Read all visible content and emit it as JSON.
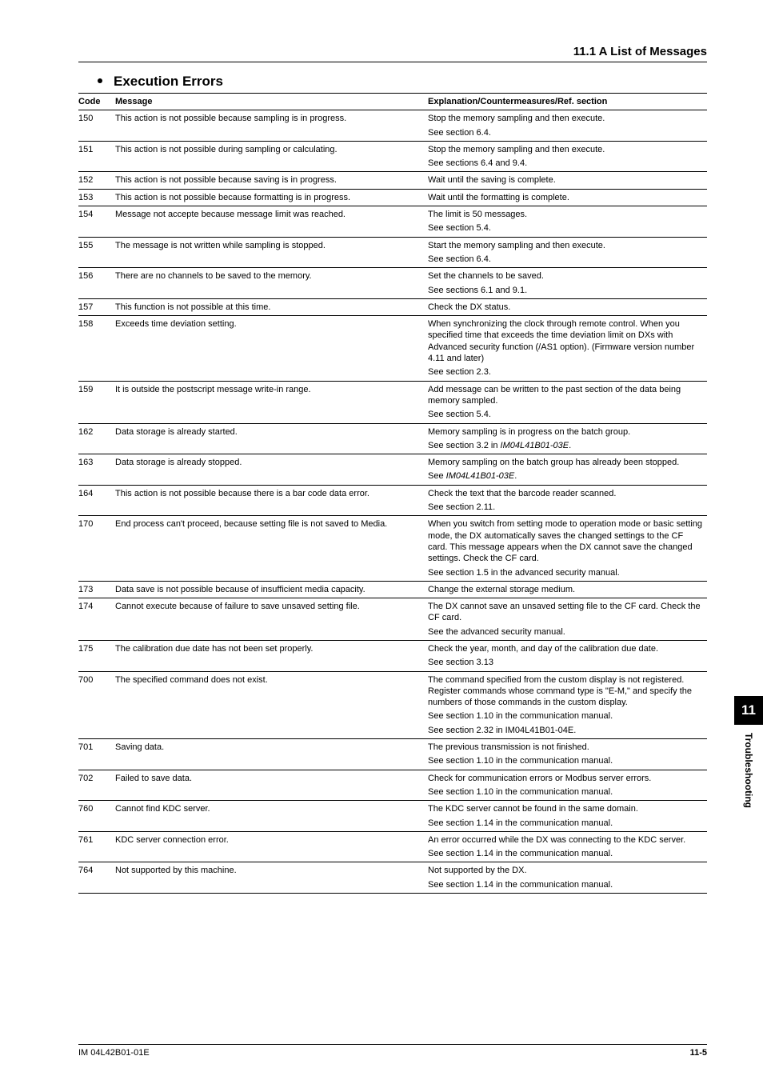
{
  "header": {
    "section": "11.1 A List of Messages"
  },
  "subtitle": "Execution Errors",
  "columns": {
    "code": "Code",
    "message": "Message",
    "explanation": "Explanation/Countermeasures/Ref. section"
  },
  "rows": [
    {
      "code": "150",
      "message": "This action is not possible because sampling is in progress.",
      "explanation": "Stop the memory sampling and then execute.",
      "ref": "See section 6.4."
    },
    {
      "code": "151",
      "message": "This action is not possible during sampling or calculating.",
      "explanation": "Stop the memory sampling and then execute.",
      "ref": "See sections 6.4 and 9.4."
    },
    {
      "code": "152",
      "message": "This action is not possible because saving is in progress.",
      "explanation": "Wait until the saving is complete."
    },
    {
      "code": "153",
      "message": "This action is not possible because formatting is in progress.",
      "explanation": "Wait until the formatting is complete."
    },
    {
      "code": "154",
      "message": "Message not accepte because message limit was reached.",
      "explanation": "The limit is 50 messages.",
      "ref": "See section 5.4."
    },
    {
      "code": "155",
      "message": "The message is not written while sampling is stopped.",
      "explanation": "Start the memory sampling and then execute.",
      "ref": "See section 6.4."
    },
    {
      "code": "156",
      "message": "There are no channels to be saved to the memory.",
      "explanation": "Set the channels to be saved.",
      "ref": "See sections 6.1 and 9.1."
    },
    {
      "code": "157",
      "message": "This function is not possible at this time.",
      "explanation": "Check the DX status."
    },
    {
      "code": "158",
      "message": "Exceeds time deviation setting.",
      "explanation": "When synchronizing the clock through remote control. When you specified time that exceeds the time deviation limit on DXs with Advanced security function (/AS1 option). (Firmware version number 4.11 and later)",
      "ref": "See section 2.3."
    },
    {
      "code": "159",
      "message": "It is outside the postscript message write-in range.",
      "explanation": "Add message can be written to the past section of the data being memory sampled.",
      "ref": "See section 5.4."
    },
    {
      "code": "162",
      "message": "Data storage is already started.",
      "explanation": "Memory sampling is in progress on the batch group.",
      "ref_html": "See section 3.2 in <em class='doc'>IM04L41B01-03E</em>."
    },
    {
      "code": "163",
      "message": "Data storage is already stopped.",
      "explanation": "Memory sampling on the batch group has already been stopped.",
      "ref_html": "See <em class='doc'>IM04L41B01-03E</em>."
    },
    {
      "code": "164",
      "message": "This action is not possible because there is a bar code data error.",
      "explanation": "Check the text that the barcode reader scanned.",
      "ref": "See section 2.11."
    },
    {
      "code": "170",
      "message": "End process can't proceed, because setting file is not saved to Media.",
      "explanation": "When you switch from setting mode to operation mode or basic setting mode, the DX automatically saves the changed settings to the CF card. This message appears when the DX cannot save the changed settings. Check the CF card.",
      "ref": "See section 1.5 in the advanced security manual."
    },
    {
      "code": "173",
      "message": "Data save is not possible because of insufficient media capacity.",
      "explanation": "Change the external storage medium."
    },
    {
      "code": "174",
      "message": "Cannot execute because of failure to save unsaved setting file.",
      "explanation": "The DX cannot save an unsaved setting file to the CF card. Check the CF card.",
      "ref": "See the advanced security manual."
    },
    {
      "code": "175",
      "message": "The calibration due date has not been set properly.",
      "explanation": "Check the year, month, and day of the calibration due date.",
      "ref": "See section 3.13"
    },
    {
      "code": "700",
      "message": "The specified command does not exist.",
      "explanation": "The command specified from the custom display is not registered. Register commands whose command type is \"E-M,\" and specify the numbers of those commands in the custom display.",
      "ref": "See section 1.10 in the communication manual.",
      "ref2": "See section 2.32 in IM04L41B01-04E."
    },
    {
      "code": "701",
      "message": "Saving data.",
      "explanation": "The previous transmission is not finished.",
      "ref": "See section 1.10 in the communication manual."
    },
    {
      "code": "702",
      "message": "Failed to save data.",
      "explanation": "Check for communication errors or Modbus server errors.",
      "ref": "See section 1.10 in the communication manual."
    },
    {
      "code": "760",
      "message": "Cannot find KDC server.",
      "explanation": "The KDC server cannot be found in the same domain.",
      "ref": "See section 1.14 in the communication manual."
    },
    {
      "code": "761",
      "message": "KDC server connection error.",
      "explanation": "An error occurred while the DX was connecting to the KDC server.",
      "ref": "See section 1.14 in the communication manual."
    },
    {
      "code": "764",
      "message": "Not supported by this machine.",
      "explanation": "Not supported by the DX.",
      "ref": "See section 1.14 in the communication manual."
    }
  ],
  "sidetab": {
    "number": "11",
    "label": "Troubleshooting"
  },
  "footer": {
    "left": "IM 04L42B01-01E",
    "right": "11-5"
  }
}
